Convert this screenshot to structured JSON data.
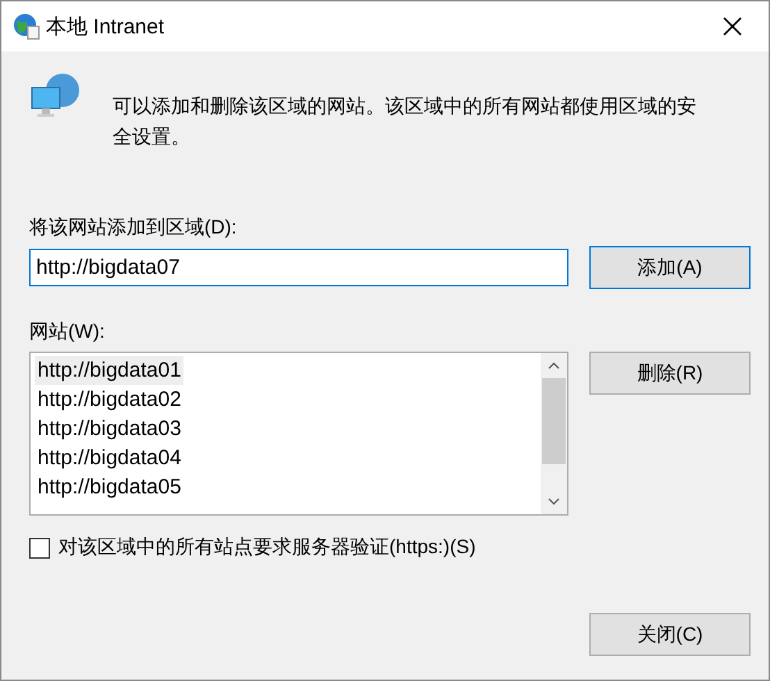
{
  "window": {
    "title": "本地 Intranet"
  },
  "description": "可以添加和删除该区域的网站。该区域中的所有网站都使用区域的安全设置。",
  "add_field": {
    "label": "将该网站添加到区域(D):",
    "value": "http://bigdata07"
  },
  "add_button": "添加(A)",
  "sites": {
    "label": "网站(W):",
    "items": [
      {
        "text": "http://bigdata01",
        "selected": true
      },
      {
        "text": "http://bigdata02",
        "selected": false
      },
      {
        "text": "http://bigdata03",
        "selected": false
      },
      {
        "text": "http://bigdata04",
        "selected": false
      },
      {
        "text": "http://bigdata05",
        "selected": false
      }
    ]
  },
  "remove_button": "删除(R)",
  "require_https": {
    "label": "对该区域中的所有站点要求服务器验证(https:)(S)",
    "checked": false
  },
  "close_button": "关闭(C)"
}
